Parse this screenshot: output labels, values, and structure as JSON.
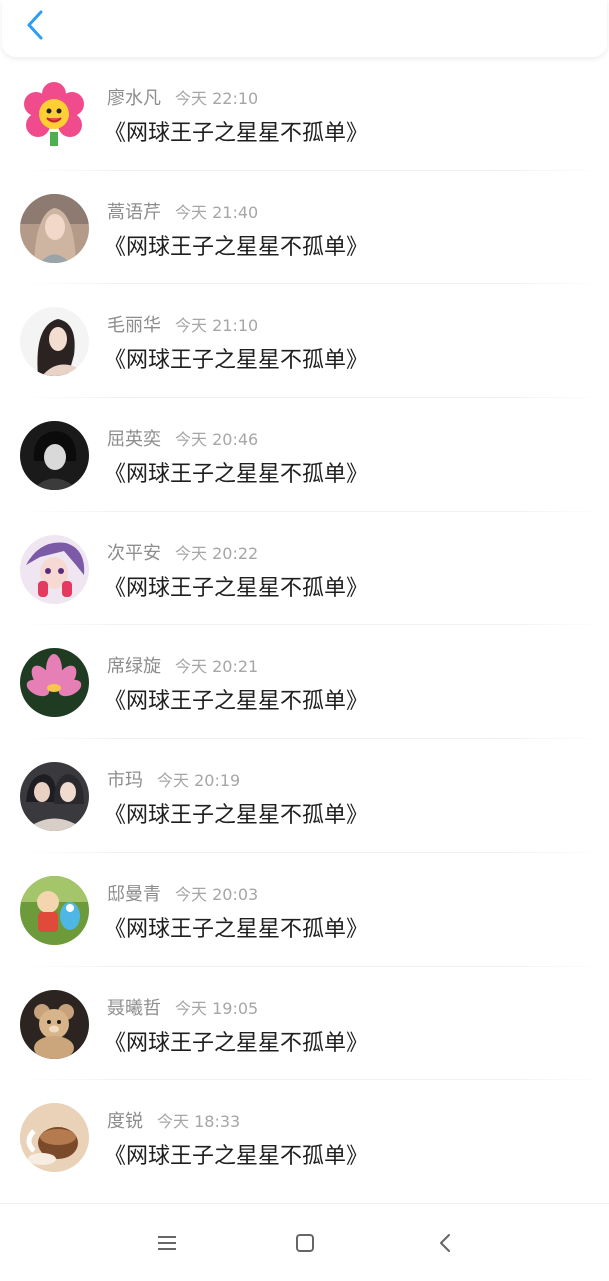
{
  "header": {
    "back_icon": "chevron-left-icon",
    "accent": "#2b9df4"
  },
  "messages": [
    {
      "name": "廖水凡",
      "time": "今天 22:10",
      "text": "《网球王子之星星不孤单》",
      "avatar": "cartoon-flower"
    },
    {
      "name": "蒿语芹",
      "time": "今天 21:40",
      "text": "《网球王子之星星不孤单》",
      "avatar": "girl-long-hair"
    },
    {
      "name": "毛丽华",
      "time": "今天 21:10",
      "text": "《网球王子之星星不孤单》",
      "avatar": "girl-dark-hair"
    },
    {
      "name": "屈英奕",
      "time": "今天 20:46",
      "text": "《网球王子之星星不孤单》",
      "avatar": "dark-boy-illustration"
    },
    {
      "name": "次平安",
      "time": "今天 20:22",
      "text": "《网球王子之星星不孤单》",
      "avatar": "anime-purple"
    },
    {
      "name": "席绿旋",
      "time": "今天 20:21",
      "text": "《网球王子之星星不孤单》",
      "avatar": "pink-lotus"
    },
    {
      "name": "市玛",
      "time": "今天 20:19",
      "text": "《网球王子之星星不孤单》",
      "avatar": "couple-selfie"
    },
    {
      "name": "邸曼青",
      "time": "今天 20:03",
      "text": "《网球王子之星星不孤单》",
      "avatar": "cartoon-bird"
    },
    {
      "name": "聂曦哲",
      "time": "今天 19:05",
      "text": "《网球王子之星星不孤单》",
      "avatar": "teddy-bear"
    },
    {
      "name": "度锐",
      "time": "今天 18:33",
      "text": "《网球王子之星星不孤单》",
      "avatar": "coffee-cup"
    }
  ],
  "navbar": {
    "icons": [
      "menu-icon",
      "home-square-icon",
      "back-triangle-icon"
    ]
  }
}
